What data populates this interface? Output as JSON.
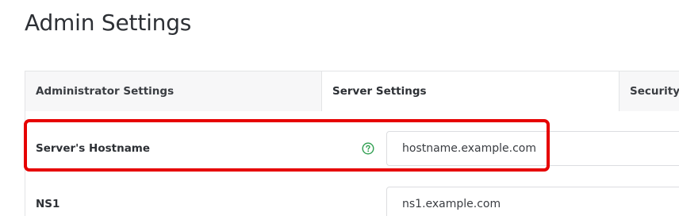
{
  "page": {
    "title": "Admin Settings"
  },
  "tabs": [
    {
      "label": "Administrator Settings",
      "active": false
    },
    {
      "label": "Server Settings",
      "active": true
    },
    {
      "label": "Security Settings",
      "active": false
    }
  ],
  "settings": {
    "hostname": {
      "label": "Server's Hostname",
      "value": "hostname.example.com",
      "help_icon": "question-circle-icon"
    },
    "ns1": {
      "label": "NS1",
      "value": "ns1.example.com"
    }
  },
  "colors": {
    "highlight": "#e60000",
    "help_icon": "#2e9e4f",
    "tab_background": "#f7f7f8",
    "border": "#e3e4e6"
  }
}
